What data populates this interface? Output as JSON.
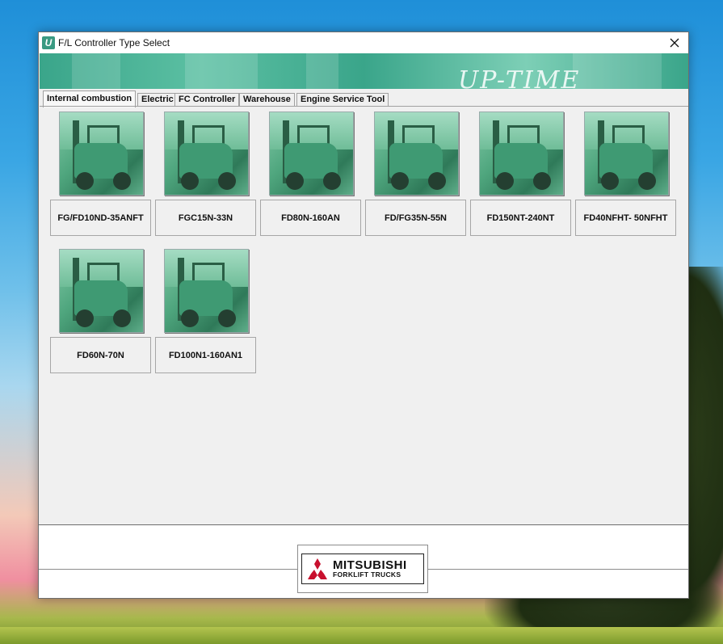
{
  "window": {
    "title": "F/L Controller Type Select",
    "app_icon_letter": "U"
  },
  "banner": {
    "logo_text": "UP-TIME"
  },
  "tabs": [
    {
      "label": "Internal combustion",
      "active": true
    },
    {
      "label": "Electric",
      "active": false
    },
    {
      "label": "FC Controller",
      "active": false
    },
    {
      "label": "Warehouse",
      "active": false
    },
    {
      "label": "Engine Service Tool",
      "active": false
    }
  ],
  "models": [
    {
      "label": "FG/FD10ND-35ANFT"
    },
    {
      "label": "FGC15N-33N"
    },
    {
      "label": "FD80N-160AN"
    },
    {
      "label": "FD/FG35N-55N"
    },
    {
      "label": "FD150NT-240NT"
    },
    {
      "label": "FD40NFHT- 50NFHT"
    },
    {
      "label": "FD60N-70N"
    },
    {
      "label": "FD100N1-160AN1"
    }
  ],
  "footer": {
    "brand_main": "MITSUBISHI",
    "brand_sub": "FORKLIFT TRUCKS",
    "brand_color": "#c8102e"
  }
}
